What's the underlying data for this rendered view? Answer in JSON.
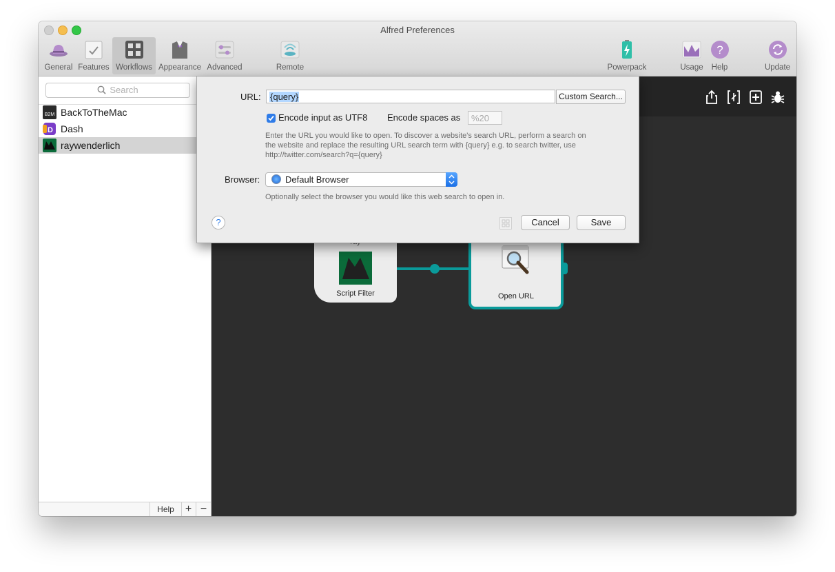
{
  "window": {
    "title": "Alfred Preferences"
  },
  "toolbar": {
    "items": [
      {
        "label": "General",
        "icon": "hat-icon"
      },
      {
        "label": "Features",
        "icon": "features-checklist-icon"
      },
      {
        "label": "Workflows",
        "icon": "workflows-grid-icon",
        "active": true
      },
      {
        "label": "Appearance",
        "icon": "tuxedo-icon"
      },
      {
        "label": "Advanced",
        "icon": "sliders-icon"
      },
      {
        "label": "Remote",
        "icon": "remote-wireless-icon"
      },
      {
        "label": "Powerpack",
        "icon": "battery-bolt-icon"
      },
      {
        "label": "Usage",
        "icon": "usage-chart-icon"
      },
      {
        "label": "Help",
        "icon": "help-question-icon"
      },
      {
        "label": "Update",
        "icon": "update-refresh-icon"
      }
    ]
  },
  "sidebar": {
    "search_placeholder": "Search",
    "workflows": [
      {
        "name": "BackToTheMac",
        "icon_text": "B2M"
      },
      {
        "name": "Dash",
        "icon_text": "D"
      },
      {
        "name": "raywenderlich",
        "selected": true
      }
    ],
    "footer": {
      "help": "Help",
      "add": "+",
      "remove": "−"
    }
  },
  "canvas": {
    "nodes": {
      "script_filter": {
        "label": "Script Filter",
        "top_text": "ray"
      },
      "open_url": {
        "label": "Open URL"
      }
    }
  },
  "dialog": {
    "url_label": "URL:",
    "url_value": "{query}",
    "custom_search_button": "Custom Search...",
    "encode_utf8_label": "Encode input as UTF8",
    "encode_utf8_checked": true,
    "encode_spaces_label": "Encode spaces as",
    "encode_spaces_placeholder": "%20",
    "url_help_lines": [
      "Enter the URL you would like to open. To discover a website's search URL, perform a search on",
      "the website and replace the resulting URL search term with {query} e.g. to search twitter, use",
      "http://twitter.com/search?q={query}"
    ],
    "browser_label": "Browser:",
    "browser_value": "Default Browser",
    "browser_help": "Optionally select the browser you would like this web search to open in.",
    "help_button": "?",
    "cancel_button": "Cancel",
    "save_button": "Save"
  },
  "colors": {
    "accent_teal": "#0a9a9a",
    "selection_blue": "#2f7ce8",
    "canvas_bg": "#2d2d2d"
  }
}
